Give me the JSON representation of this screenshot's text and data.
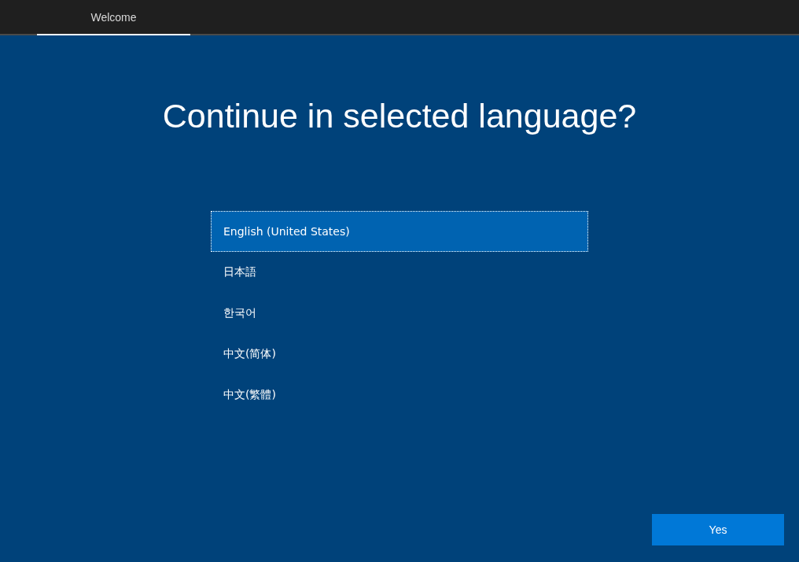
{
  "tabs": [
    {
      "label": "Welcome",
      "selected": true
    }
  ],
  "title": "Continue in selected language?",
  "languages": [
    {
      "label": "English (United States)",
      "selected": true
    },
    {
      "label": "日本語",
      "selected": false
    },
    {
      "label": "한국어",
      "selected": false
    },
    {
      "label": "中文(简体)",
      "selected": false
    },
    {
      "label": "中文(繁體)",
      "selected": false
    }
  ],
  "buttons": [
    "Yes"
  ]
}
